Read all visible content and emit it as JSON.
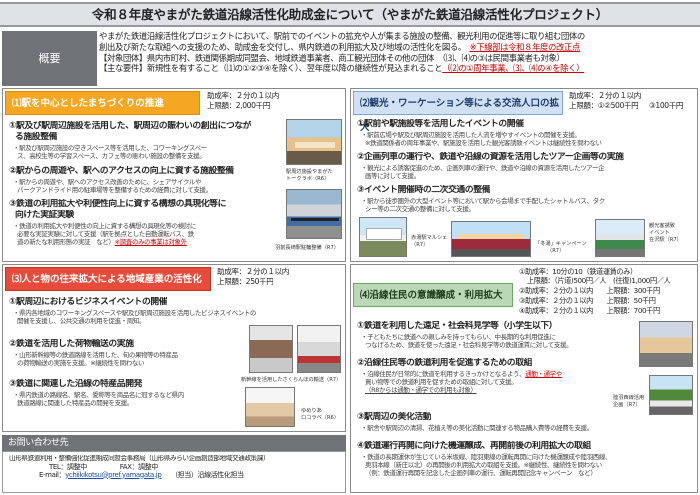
{
  "title": "令和８年度やまがた鉄道沿線活性化助成金について（やまがた鉄道沿線活性化プロジェクト）",
  "overview": {
    "label": "概要",
    "line1": "やまがた鉄道沿線活性化プロジェクトにおいて、駅前でのイベントの拡充や人が集まる施設の整備、観光利用の促進等に取り組む団体の",
    "line2a": "創出及び新たな取組への支援のため、助成金を交付し、県内鉄道の利用拡大及び地域の活性化を図る。",
    "line2b": "※下線部は令和８年度の改正点",
    "line3": "【対象団体】県内市町村、鉄道関係期成同盟会、地域鉄道事業者、商工観光団体その他の団体　（⑶、⑷の③は民間事業者も対象）",
    "line4a": "【主な要件】新規性を有すること（⑴の①②③④を除く）、翌年度以降の継続性が見込まれること",
    "line4b": "（⑵の①周年事業、⑶、⑷の④を除く）"
  },
  "p1": {
    "header": "⑴駅を中心としたまちづくりの推進",
    "rate": "助成率：２分の１以内",
    "limit": "上限額：2,000千円",
    "i1t": "①駅及び駅周辺施設を活用した、駅周辺の賑わいの創出につなが",
    "i1t2": "る施設整備",
    "i1b": "・駅及び駅周辺施設の空きスペース等を活用した、コワーキングスペー",
    "i1b2": "ス、高校生等の学習スペース、カフェ等の賑わい施設の整備を支援。",
    "i2t": "②駅からの周遊や、駅へのアクセスの向上に資する施設整備",
    "i2b": "・駅からの周遊や、駅へのアクセス改善のために、シェアサイクルや",
    "i2b2": "パークアンドライド用の駐車場等を整備するための経費に対して支援。",
    "i3t": "③鉄道の利用拡大や利便性向上に資する構想の具現化等に",
    "i3t2": "向けた実証実験",
    "i3b": "・鉄道の利用拡大や利便性の向上に資する構想の具現化等の検討に",
    "i3b2": "必要な実証実験に対して支援（駅を拠点とした自動運転バス、鉄",
    "i3b3": "道の新たな利用形態の実証　など）",
    "i3b3u": "※調査のみの事業は対象外",
    "cap1": "駅周辺施設やまがた",
    "cap1b": "トークラボ（R6）",
    "cap2": "羽前長崎駅駐輪整備（R7）"
  },
  "p2": {
    "header": "⑵観光・ワーケーション等による交流人口の拡大",
    "rate": "助成率：２分の１以内",
    "limit_a": "上限額：①②500千円",
    "limit_b": "③100千円",
    "i1t": "①駅前や駅施設等を活用したイベントの開催",
    "i1b": "・駅前広場や駅及び駅周辺施設を活用した人流を増やすイベントの開催を支援。",
    "i1b2": "※鉄道関係者の周年事業や、駅施設を活用した観光客誘致イベントは継続性を問わない",
    "i2t": "②企画列車の運行や、鉄道や沿線の資源を活用したツアー企画等の実施",
    "i2b": "・観光による誘客促進のため、企画列車の運行や、鉄道や沿線の資源を活用したツアー企",
    "i2b2": "画等に対して支援。",
    "i3t": "③イベント開催時の二次交通の整備",
    "i3b": "・駅から徒歩圏外の大型イベント等において駅から会場まで手配したシャトルバス、タク",
    "i3b2": "シー等の二次交通の整備に対して支援。",
    "cap1": "赤湯駅マルシェ",
    "cap1b": "（R7）",
    "cap2": "「冬湯」キャンペーン",
    "cap2b": "（R7）",
    "cap3": "観光客誘致",
    "cap3b": "イベント",
    "cap3c": "在沢駅（R7）"
  },
  "p3": {
    "header": "⑶人と物の往来拡大による地域産業の活性化",
    "rate": "助成率：２分の１以内",
    "limit": "上限額：250千円",
    "i1t": "①駅周辺におけるビジネスイベントの開催",
    "i1b": "・県内各地域のコワーキングスペースや駅及び駅周辺施設を活用したビジネスイベントの",
    "i1b2": "開催を支援し、公共交通の利用を促進・周知。",
    "i2t": "②鉄道を活用した荷物輸送の実施",
    "i2b": "・山形新幹線等の鉄道路線を活用した、旬の果物等の特産品",
    "i2b2": "の荷物輸送の実施を支援。※継続性を問わない",
    "i3t": "③鉄道に関連した沿線の特産品開発",
    "i3b": "・県内鉄道の路線名、駅名、愛称等を商品名に冠するなど県内",
    "i3b2": "鉄道路線に関連した特産品の開発を支援。",
    "cap1": "新幹線を活用したさくらんぼの輸送（R7）",
    "cap2": "ゆめりあ",
    "cap2b": "ロコラベ（R6）"
  },
  "p4": {
    "header": "⑷沿線住民の意識醸成・利用拡大",
    "r1": "①助成率：10分の10（鉄道運賃のみ）",
    "r1b": "上限額：（片道)500円／人　(往復)1,000円／人",
    "r2": "②助成率：２分の１以内　　上限額：300千円",
    "r3": "③助成率：２分の１以内　　上限額：50千円",
    "r4": "④助成率：２分の１以内　　上限額：700千円",
    "i1t": "①鉄道を利用した遠足・社会科見学等（小学生以下）",
    "i1b": "・子どもたちに鉄道への親しみを持ってもらい、中長期的な利用促進に",
    "i1b2": "つなげるため、鉄道を使った遠足・社会科見学等の鉄道運賃に対して支援。",
    "i2t": "②沿線住民等の鉄道利用を促進するための取組",
    "i2b": "・沿線住民が日常的に鉄道を利用するきっかけとなるよう、",
    "i2b_u": "通勤・通学や",
    "i2b2": "買い物等での鉄道利用を促すための取組に対して支援。",
    "i2b3": "（R8からは通勤・通学での利用も対象）",
    "i3t": "③駅周辺の美化活動",
    "i3b": "・駅舎や駅周辺の清掃、花植え等の美化活動に関連する物品購入費等の経費を支援。",
    "i4t": "④鉄道運行再開に向けた機運醸成、再開前後の利用拡大の取組",
    "i4b": "・鉄道の長期運休が生じている米坂線、陸羽東線の運転再開に向けた機運醸成や陸羽西線、",
    "i4b2": "奥羽本線（新庄以北）の再開後の利用拡大の取組を支援。※継続性、継続性を問わない",
    "i4b3": "（例：鉄道運行再開を記念した企画列車の運行、運転再開記念キャンペーン　など）",
    "cap1": "陸羽西線活用",
    "cap1b": "企画（R7）"
  },
  "contact": {
    "header": "お問い合わせ先",
    "l1": "山形県鉄道利用・整備強化促進期成同盟会事務局（山形県みらい企画創造部地域交通政策課）",
    "l2": "TEL：調整中　　　　　FAX：調整中",
    "l3a": "E-mail：",
    "l3mail": "ychiikikotsu@pref.yamagata.jp",
    "l3b": "（担当）沿線活性化担当"
  }
}
